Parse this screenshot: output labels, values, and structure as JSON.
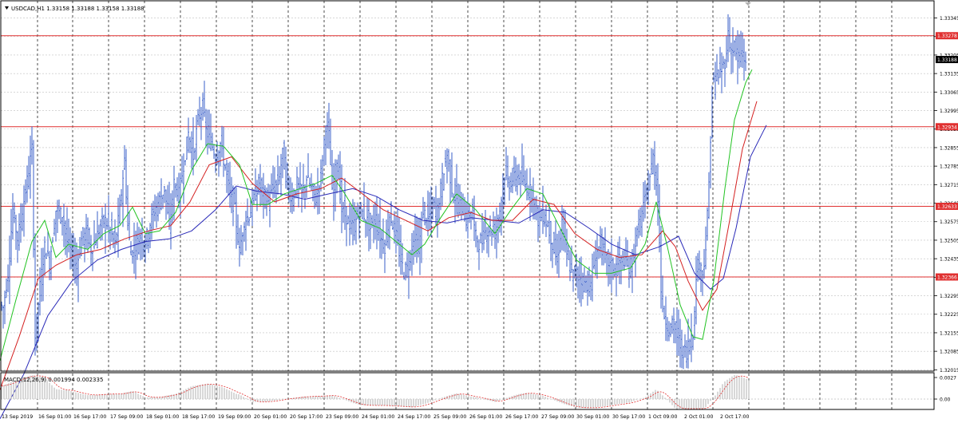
{
  "colors": {
    "background": "#ffffff",
    "grid": "#c0c0c0",
    "vgrid": "#000000",
    "candle": "#3a5fc8",
    "ma_fast": "#22c322",
    "ma_mid": "#d42020",
    "ma_slow": "#2a2ab8",
    "hline": "#e03030",
    "macd_hist": "#c8c8c8",
    "macd_signal": "#e03030"
  },
  "header": {
    "symbol_label": "USDCAD,H1  1.33158 1.33188 1.33158 1.33188",
    "dropdown_icon": "triangle-down-icon"
  },
  "indicator": {
    "label": "MACD(12,26,9) 0.001994 0.002335",
    "axis_labels": [
      "0.0027",
      "0.00"
    ]
  },
  "chart_data": {
    "type": "candlestick",
    "instrument": "USDCAD",
    "timeframe": "H1",
    "ylim": [
      1.3201,
      1.3341
    ],
    "yticks": [
      "1.33345",
      "1.33275",
      "1.33205",
      "1.33135",
      "1.33065",
      "1.32995",
      "1.32925",
      "1.32855",
      "1.32785",
      "1.32715",
      "1.32645",
      "1.32575",
      "1.32505",
      "1.32435",
      "1.32365",
      "1.32295",
      "1.32225",
      "1.32155",
      "1.32085",
      "1.32015"
    ],
    "ytick_values": [
      1.33345,
      1.33275,
      1.33205,
      1.33135,
      1.33065,
      1.32995,
      1.32925,
      1.32855,
      1.32785,
      1.32715,
      1.32645,
      1.32575,
      1.32505,
      1.32435,
      1.32365,
      1.32295,
      1.32225,
      1.32155,
      1.32085,
      1.32015
    ],
    "xticks": [
      "13 Sep 2019",
      "16 Sep 01:00",
      "16 Sep 17:00",
      "17 Sep 09:00",
      "18 Sep 01:00",
      "18 Sep 17:00",
      "19 Sep 09:00",
      "20 Sep 01:00",
      "20 Sep 17:00",
      "23 Sep 09:00",
      "24 Sep 01:00",
      "24 Sep 17:00",
      "25 Sep 09:00",
      "26 Sep 01:00",
      "26 Sep 17:00",
      "27 Sep 09:00",
      "30 Sep 01:00",
      "30 Sep 17:00",
      "1 Oct 09:00",
      "2 Oct 01:00",
      "2 Oct 17:00"
    ],
    "horizontal_levels": [
      {
        "label": "1.33278",
        "value": 1.33278
      },
      {
        "label": "1.32934",
        "value": 1.32934
      },
      {
        "label": "1.32633",
        "value": 1.32633
      },
      {
        "label": "1.32366",
        "value": 1.32366
      }
    ],
    "current_price": {
      "label": "1.33188",
      "value": 1.33188
    },
    "price_path": [
      [
        0,
        1.3227
      ],
      [
        6,
        1.3225
      ],
      [
        12,
        1.3238
      ],
      [
        18,
        1.3262
      ],
      [
        24,
        1.3251
      ],
      [
        28,
        1.3258
      ],
      [
        36,
        1.3273
      ],
      [
        42,
        1.3285
      ],
      [
        46,
        1.3214
      ],
      [
        52,
        1.3233
      ],
      [
        58,
        1.3248
      ],
      [
        64,
        1.3242
      ],
      [
        72,
        1.3262
      ],
      [
        80,
        1.326
      ],
      [
        86,
        1.325
      ],
      [
        92,
        1.3245
      ],
      [
        98,
        1.324
      ],
      [
        104,
        1.3251
      ],
      [
        110,
        1.3253
      ],
      [
        116,
        1.3247
      ],
      [
        122,
        1.3251
      ],
      [
        128,
        1.3256
      ],
      [
        134,
        1.3258
      ],
      [
        140,
        1.3254
      ],
      [
        146,
        1.3249
      ],
      [
        152,
        1.3262
      ],
      [
        158,
        1.3281
      ],
      [
        162,
        1.3256
      ],
      [
        166,
        1.3245
      ],
      [
        172,
        1.3249
      ],
      [
        178,
        1.3252
      ],
      [
        184,
        1.325
      ],
      [
        190,
        1.3257
      ],
      [
        196,
        1.3262
      ],
      [
        202,
        1.3266
      ],
      [
        208,
        1.327
      ],
      [
        214,
        1.3255
      ],
      [
        220,
        1.3272
      ],
      [
        226,
        1.3268
      ],
      [
        232,
        1.3279
      ],
      [
        238,
        1.3291
      ],
      [
        244,
        1.3282
      ],
      [
        250,
        1.3296
      ],
      [
        256,
        1.3301
      ],
      [
        260,
        1.3292
      ],
      [
        266,
        1.3288
      ],
      [
        272,
        1.3282
      ],
      [
        278,
        1.3287
      ],
      [
        284,
        1.3278
      ],
      [
        290,
        1.3268
      ],
      [
        296,
        1.3262
      ],
      [
        302,
        1.3246
      ],
      [
        308,
        1.3258
      ],
      [
        314,
        1.326
      ],
      [
        320,
        1.3266
      ],
      [
        326,
        1.3272
      ],
      [
        332,
        1.3268
      ],
      [
        338,
        1.3265
      ],
      [
        344,
        1.327
      ],
      [
        350,
        1.3272
      ],
      [
        356,
        1.3283
      ],
      [
        362,
        1.3271
      ],
      [
        368,
        1.3266
      ],
      [
        374,
        1.3272
      ],
      [
        380,
        1.3268
      ],
      [
        386,
        1.3274
      ],
      [
        392,
        1.327
      ],
      [
        398,
        1.3266
      ],
      [
        404,
        1.3276
      ],
      [
        410,
        1.3294
      ],
      [
        414,
        1.329
      ],
      [
        418,
        1.3268
      ],
      [
        424,
        1.3281
      ],
      [
        430,
        1.3262
      ],
      [
        436,
        1.3259
      ],
      [
        442,
        1.3255
      ],
      [
        448,
        1.3258
      ],
      [
        454,
        1.3262
      ],
      [
        460,
        1.3259
      ],
      [
        466,
        1.3255
      ],
      [
        472,
        1.3258
      ],
      [
        478,
        1.3252
      ],
      [
        484,
        1.3248
      ],
      [
        490,
        1.326
      ],
      [
        496,
        1.3255
      ],
      [
        502,
        1.3246
      ],
      [
        508,
        1.3238
      ],
      [
        514,
        1.3241
      ],
      [
        520,
        1.3252
      ],
      [
        526,
        1.3246
      ],
      [
        532,
        1.3262
      ],
      [
        538,
        1.3258
      ],
      [
        544,
        1.3264
      ],
      [
        550,
        1.3262
      ],
      [
        556,
        1.3274
      ],
      [
        562,
        1.3283
      ],
      [
        568,
        1.327
      ],
      [
        574,
        1.3265
      ],
      [
        580,
        1.3264
      ],
      [
        586,
        1.3258
      ],
      [
        592,
        1.3262
      ],
      [
        598,
        1.3252
      ],
      [
        604,
        1.3248
      ],
      [
        610,
        1.3254
      ],
      [
        616,
        1.3255
      ],
      [
        622,
        1.3253
      ],
      [
        628,
        1.3262
      ],
      [
        634,
        1.3275
      ],
      [
        640,
        1.3272
      ],
      [
        646,
        1.3274
      ],
      [
        652,
        1.3275
      ],
      [
        658,
        1.3272
      ],
      [
        664,
        1.327
      ],
      [
        670,
        1.3268
      ],
      [
        676,
        1.3258
      ],
      [
        682,
        1.326
      ],
      [
        688,
        1.3256
      ],
      [
        694,
        1.3249
      ],
      [
        700,
        1.3242
      ],
      [
        706,
        1.3258
      ],
      [
        712,
        1.3244
      ],
      [
        718,
        1.3238
      ],
      [
        724,
        1.3237
      ],
      [
        730,
        1.3236
      ],
      [
        736,
        1.3234
      ],
      [
        742,
        1.3233
      ],
      [
        748,
        1.3245
      ],
      [
        754,
        1.3249
      ],
      [
        760,
        1.3244
      ],
      [
        766,
        1.3241
      ],
      [
        772,
        1.324
      ],
      [
        778,
        1.3242
      ],
      [
        784,
        1.3243
      ],
      [
        790,
        1.3239
      ],
      [
        796,
        1.3246
      ],
      [
        802,
        1.3256
      ],
      [
        808,
        1.3263
      ],
      [
        814,
        1.3271
      ],
      [
        820,
        1.3282
      ],
      [
        826,
        1.3267
      ],
      [
        830,
        1.3232
      ],
      [
        834,
        1.3222
      ],
      [
        840,
        1.3217
      ],
      [
        846,
        1.3219
      ],
      [
        852,
        1.3212
      ],
      [
        858,
        1.3208
      ],
      [
        864,
        1.3211
      ],
      [
        870,
        1.3216
      ],
      [
        876,
        1.3244
      ],
      [
        882,
        1.3238
      ],
      [
        886,
        1.3248
      ],
      [
        890,
        1.3272
      ],
      [
        894,
        1.3308
      ],
      [
        898,
        1.3312
      ],
      [
        902,
        1.3313
      ],
      [
        906,
        1.3315
      ],
      [
        910,
        1.3318
      ],
      [
        914,
        1.3328
      ],
      [
        918,
        1.3322
      ],
      [
        922,
        1.3324
      ],
      [
        926,
        1.3318
      ],
      [
        930,
        1.3321
      ],
      [
        934,
        1.3319
      ]
    ],
    "ma_fast_path": [
      [
        0,
        1.3205
      ],
      [
        20,
        1.3228
      ],
      [
        40,
        1.325
      ],
      [
        56,
        1.3258
      ],
      [
        70,
        1.3244
      ],
      [
        86,
        1.3249
      ],
      [
        110,
        1.3247
      ],
      [
        130,
        1.3253
      ],
      [
        150,
        1.3256
      ],
      [
        166,
        1.3263
      ],
      [
        182,
        1.3253
      ],
      [
        200,
        1.3254
      ],
      [
        220,
        1.3261
      ],
      [
        240,
        1.3277
      ],
      [
        260,
        1.3287
      ],
      [
        280,
        1.3286
      ],
      [
        300,
        1.3279
      ],
      [
        316,
        1.3264
      ],
      [
        336,
        1.3264
      ],
      [
        356,
        1.3268
      ],
      [
        376,
        1.327
      ],
      [
        396,
        1.3272
      ],
      [
        416,
        1.3275
      ],
      [
        432,
        1.3268
      ],
      [
        452,
        1.3258
      ],
      [
        476,
        1.3255
      ],
      [
        496,
        1.325
      ],
      [
        516,
        1.3245
      ],
      [
        532,
        1.3249
      ],
      [
        552,
        1.3259
      ],
      [
        572,
        1.3268
      ],
      [
        596,
        1.3262
      ],
      [
        620,
        1.3253
      ],
      [
        640,
        1.3262
      ],
      [
        660,
        1.327
      ],
      [
        680,
        1.3268
      ],
      [
        700,
        1.3256
      ],
      [
        722,
        1.3243
      ],
      [
        744,
        1.3238
      ],
      [
        766,
        1.3238
      ],
      [
        790,
        1.324
      ],
      [
        808,
        1.3249
      ],
      [
        822,
        1.3265
      ],
      [
        836,
        1.3248
      ],
      [
        852,
        1.3226
      ],
      [
        868,
        1.3214
      ],
      [
        880,
        1.3213
      ],
      [
        894,
        1.3235
      ],
      [
        908,
        1.327
      ],
      [
        920,
        1.3296
      ],
      [
        934,
        1.331
      ],
      [
        942,
        1.3315
      ]
    ],
    "ma_mid_path": [
      [
        0,
        1.3194
      ],
      [
        24,
        1.3214
      ],
      [
        48,
        1.3236
      ],
      [
        70,
        1.3241
      ],
      [
        96,
        1.3245
      ],
      [
        126,
        1.3247
      ],
      [
        156,
        1.3251
      ],
      [
        186,
        1.3254
      ],
      [
        214,
        1.3256
      ],
      [
        238,
        1.3265
      ],
      [
        262,
        1.3279
      ],
      [
        290,
        1.3282
      ],
      [
        316,
        1.3272
      ],
      [
        344,
        1.3265
      ],
      [
        372,
        1.3268
      ],
      [
        402,
        1.327
      ],
      [
        428,
        1.3274
      ],
      [
        454,
        1.3268
      ],
      [
        480,
        1.3262
      ],
      [
        508,
        1.3258
      ],
      [
        536,
        1.3254
      ],
      [
        562,
        1.3259
      ],
      [
        590,
        1.3261
      ],
      [
        616,
        1.3258
      ],
      [
        642,
        1.3258
      ],
      [
        668,
        1.3266
      ],
      [
        694,
        1.3264
      ],
      [
        720,
        1.3253
      ],
      [
        748,
        1.3247
      ],
      [
        776,
        1.3244
      ],
      [
        804,
        1.3245
      ],
      [
        830,
        1.3254
      ],
      [
        846,
        1.3248
      ],
      [
        862,
        1.3235
      ],
      [
        880,
        1.3224
      ],
      [
        898,
        1.3232
      ],
      [
        914,
        1.3258
      ],
      [
        930,
        1.3285
      ],
      [
        948,
        1.3303
      ]
    ],
    "ma_slow_path": [
      [
        0,
        1.3183
      ],
      [
        30,
        1.32
      ],
      [
        60,
        1.3222
      ],
      [
        90,
        1.3235
      ],
      [
        122,
        1.3243
      ],
      [
        152,
        1.3247
      ],
      [
        182,
        1.325
      ],
      [
        212,
        1.3251
      ],
      [
        240,
        1.3254
      ],
      [
        270,
        1.3262
      ],
      [
        296,
        1.3271
      ],
      [
        322,
        1.3269
      ],
      [
        352,
        1.3268
      ],
      [
        382,
        1.3266
      ],
      [
        412,
        1.3268
      ],
      [
        442,
        1.327
      ],
      [
        472,
        1.3267
      ],
      [
        500,
        1.3262
      ],
      [
        530,
        1.3258
      ],
      [
        560,
        1.3257
      ],
      [
        590,
        1.3259
      ],
      [
        620,
        1.3258
      ],
      [
        650,
        1.3257
      ],
      [
        680,
        1.3262
      ],
      [
        708,
        1.3261
      ],
      [
        738,
        1.3255
      ],
      [
        766,
        1.3249
      ],
      [
        796,
        1.3245
      ],
      [
        826,
        1.3248
      ],
      [
        850,
        1.3252
      ],
      [
        870,
        1.3238
      ],
      [
        890,
        1.3232
      ],
      [
        906,
        1.3236
      ],
      [
        922,
        1.3255
      ],
      [
        940,
        1.3282
      ],
      [
        960,
        1.3294
      ]
    ]
  }
}
